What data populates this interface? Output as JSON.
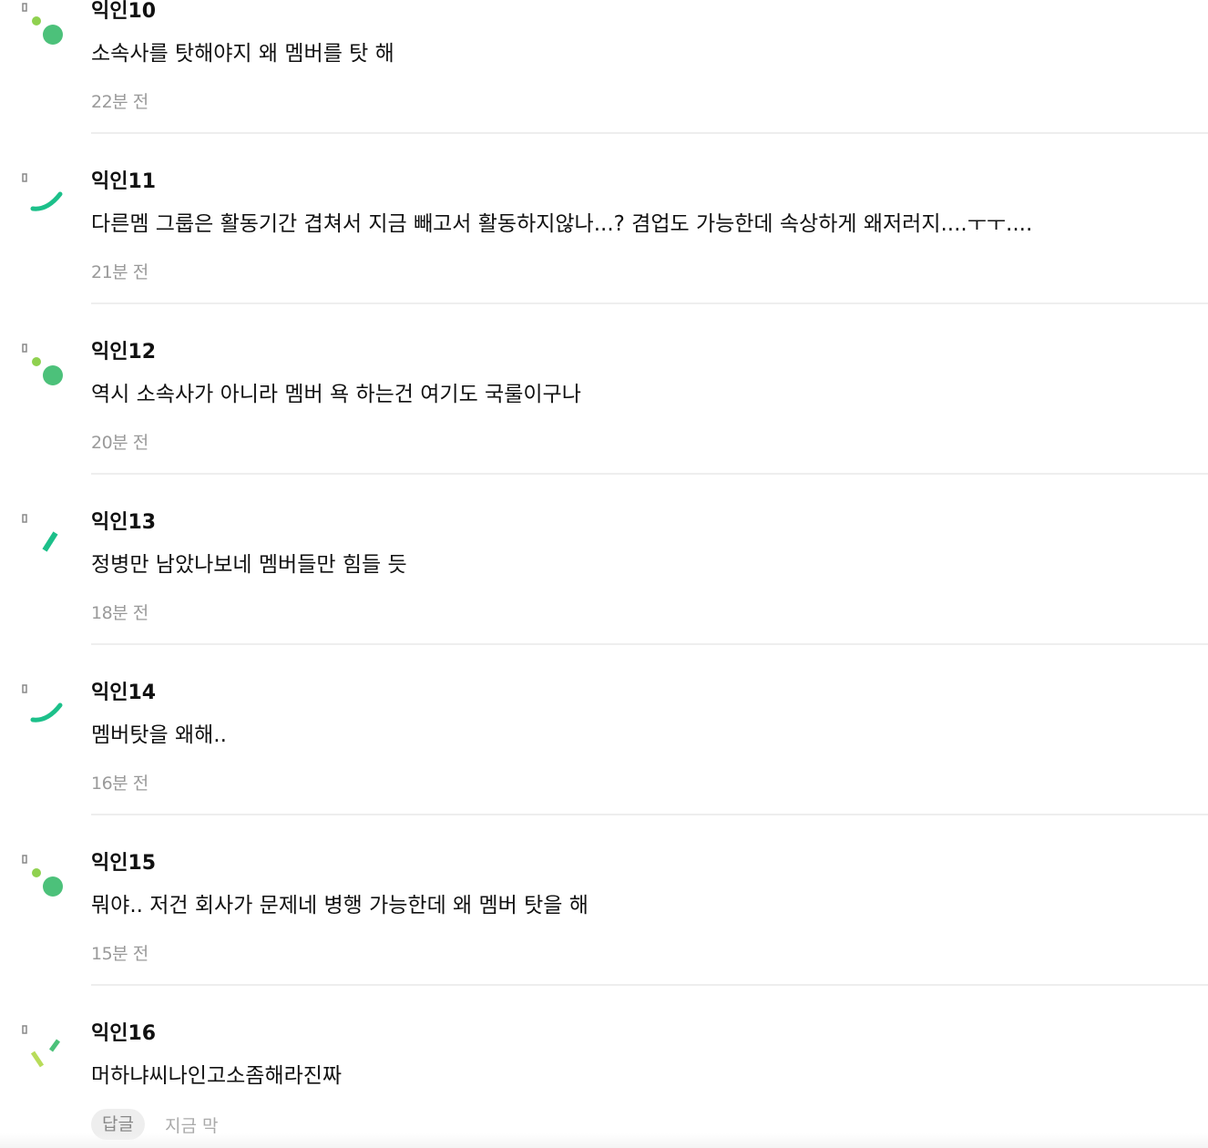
{
  "comments": [
    {
      "author": "익인10",
      "text": "소속사를 탓해야지 왜 멤버를 탓 해",
      "time": "22분 전",
      "avatar_icon": "dot-circle-avatar-icon"
    },
    {
      "author": "익인11",
      "text": "다른멤 그룹은 활동기간 겹쳐서 지금 빼고서 활동하지않나...? 겸업도 가능한데 속상하게 왜저러지....ㅜㅜ....",
      "time": "21분 전",
      "avatar_icon": "arc-avatar-icon"
    },
    {
      "author": "익인12",
      "text": "역시 소속사가 아니라 멤버 욕 하는건 여기도 국룰이구나",
      "time": "20분 전",
      "avatar_icon": "dot-circle-avatar-icon"
    },
    {
      "author": "익인13",
      "text": "정병만 남았나보네 멤버들만 힘들 듯",
      "time": "18분 전",
      "avatar_icon": "slash-avatar-icon"
    },
    {
      "author": "익인14",
      "text": "멤버탓을 왜해..",
      "time": "16분 전",
      "avatar_icon": "arc-avatar-icon"
    },
    {
      "author": "익인15",
      "text": "뭐야.. 저건 회사가 문제네 병행 가능한데 왜 멤버 탓을 해",
      "time": "15분 전",
      "avatar_icon": "dot-circle-avatar-icon"
    },
    {
      "author": "익인16",
      "text": "머하냐씨나인고소좀해라진짜",
      "time": "지금 막",
      "avatar_icon": "sparkle-avatar-icon"
    }
  ],
  "last_comment_actions": {
    "reply_label": "답글"
  },
  "colors": {
    "avatar_green": "#4cc17a",
    "avatar_teal": "#1cc08a",
    "avatar_lime": "#8fd14f",
    "avatar_gray": "#888888",
    "time_text": "#9a9a9a",
    "divider": "#eeeeee"
  }
}
